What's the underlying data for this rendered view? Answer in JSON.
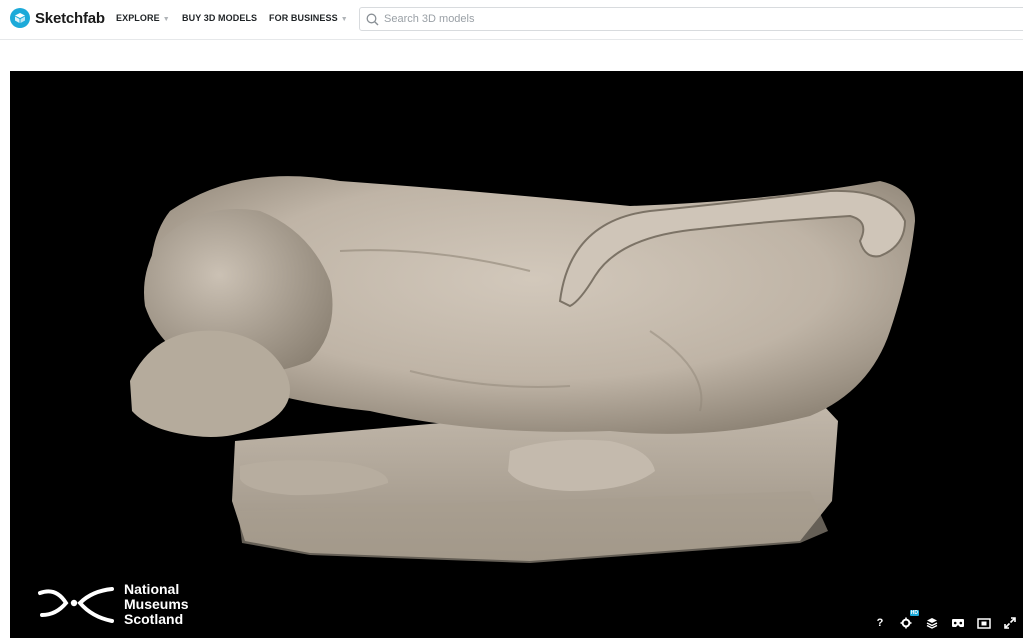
{
  "brand": {
    "name": "Sketchfab",
    "accent": "#1caad9"
  },
  "nav": {
    "explore": "EXPLORE",
    "buy": "BUY 3D MODELS",
    "business": "FOR BUSINESS"
  },
  "search": {
    "placeholder": "Search 3D models"
  },
  "viewer": {
    "background": "#000000",
    "watermark": {
      "lines": [
        "National",
        "Museums",
        "Scotland"
      ]
    },
    "controls": {
      "help": "?",
      "hd_badge": "HD"
    }
  }
}
